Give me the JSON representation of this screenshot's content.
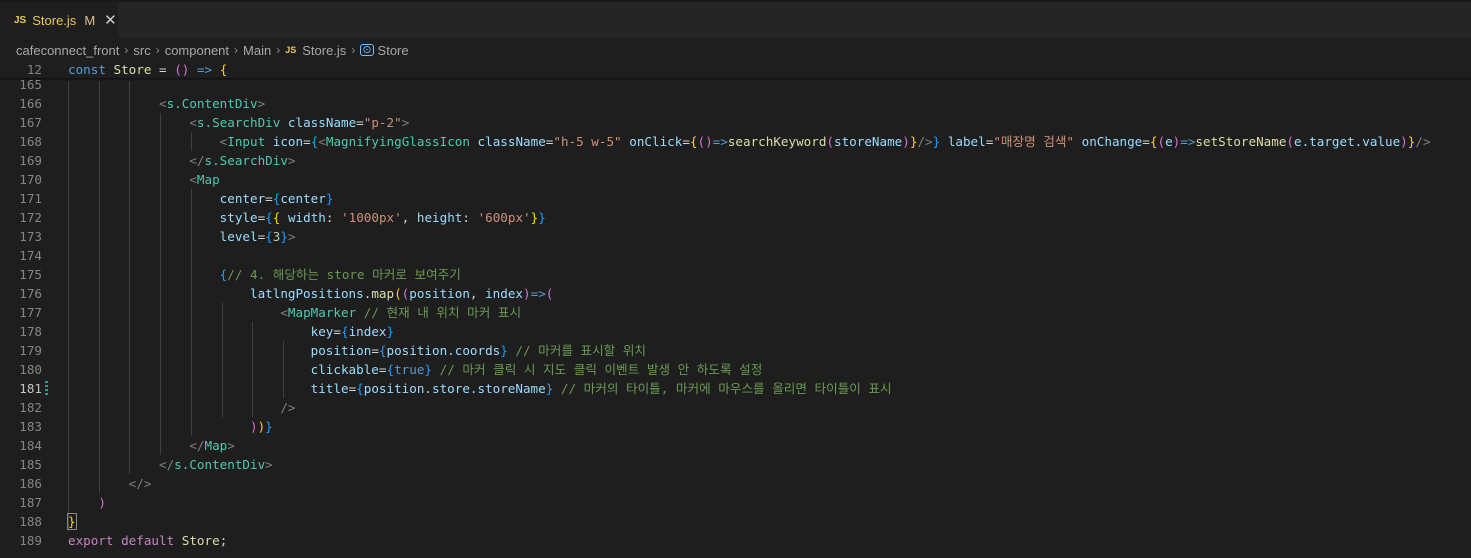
{
  "tab": {
    "badge": "JS",
    "name": "Store.js",
    "modified": "M",
    "close": "✕"
  },
  "breadcrumb": {
    "items": [
      "cafeconnect_front",
      "src",
      "component",
      "Main"
    ],
    "file": "Store.js",
    "file_badge": "JS",
    "symbol": "Store"
  },
  "sticky": {
    "line_number": "12",
    "keyword": "const",
    "name": "Store",
    "rest": " = () => {"
  },
  "line_numbers": [
    "165",
    "166",
    "167",
    "168",
    "169",
    "170",
    "171",
    "172",
    "173",
    "174",
    "175",
    "176",
    "177",
    "178",
    "179",
    "180",
    "181",
    "182",
    "183",
    "184",
    "185",
    "186",
    "187",
    "188",
    "189"
  ],
  "code": {
    "l166_tag": "s.ContentDiv",
    "l167_tag": "s.SearchDiv",
    "l167_attr": "className",
    "l167_val": "\"p-2\"",
    "l168_tag": "Input",
    "l168_a1": "icon",
    "l168_tag2": "MagnifyingGlassIcon",
    "l168_a2": "className",
    "l168_v2": "\"h-5 w-5\"",
    "l168_a3": "onClick",
    "l168_fn": "searchKeyword",
    "l168_arg": "storeName",
    "l168_a4": "label",
    "l168_v4": "\"매장명 검색\"",
    "l168_a5": "onChange",
    "l168_e": "e",
    "l168_fn2": "setStoreName",
    "l168_arg2": "e.target.value",
    "l169_tag": "s.SearchDiv",
    "l170_tag": "Map",
    "l171_attr": "center",
    "l171_val": "center",
    "l172_attr": "style",
    "l172_k1": "width",
    "l172_v1": "'1000px'",
    "l172_k2": "height",
    "l172_v2": "'600px'",
    "l173_attr": "level",
    "l173_val": "3",
    "l175_comment": "// 4. 해당하는 store 마커로 보여주기",
    "l176_var": "latlngPositions",
    "l176_fn": "map",
    "l176_p1": "position",
    "l176_p2": "index",
    "l177_tag": "MapMarker",
    "l177_comment": "// 현재 내 위치 마커 표시",
    "l178_attr": "key",
    "l178_val": "index",
    "l179_attr": "position",
    "l179_val": "position.coords",
    "l179_comment": "// 마커를 표시할 위치",
    "l180_attr": "clickable",
    "l180_val": "true",
    "l180_comment": "// 마커 클릭 시 지도 클릭 이벤트 발생 안 하도록 설정",
    "l181_attr": "title",
    "l181_val": "position.store.storeName",
    "l181_comment": "// 마커의 타이틀, 마커에 마우스를 올리면 타이틀이 표시",
    "l184_tag": "Map",
    "l185_tag": "s.ContentDiv",
    "l189_kw1": "export",
    "l189_kw2": "default",
    "l189_name": "Store"
  }
}
